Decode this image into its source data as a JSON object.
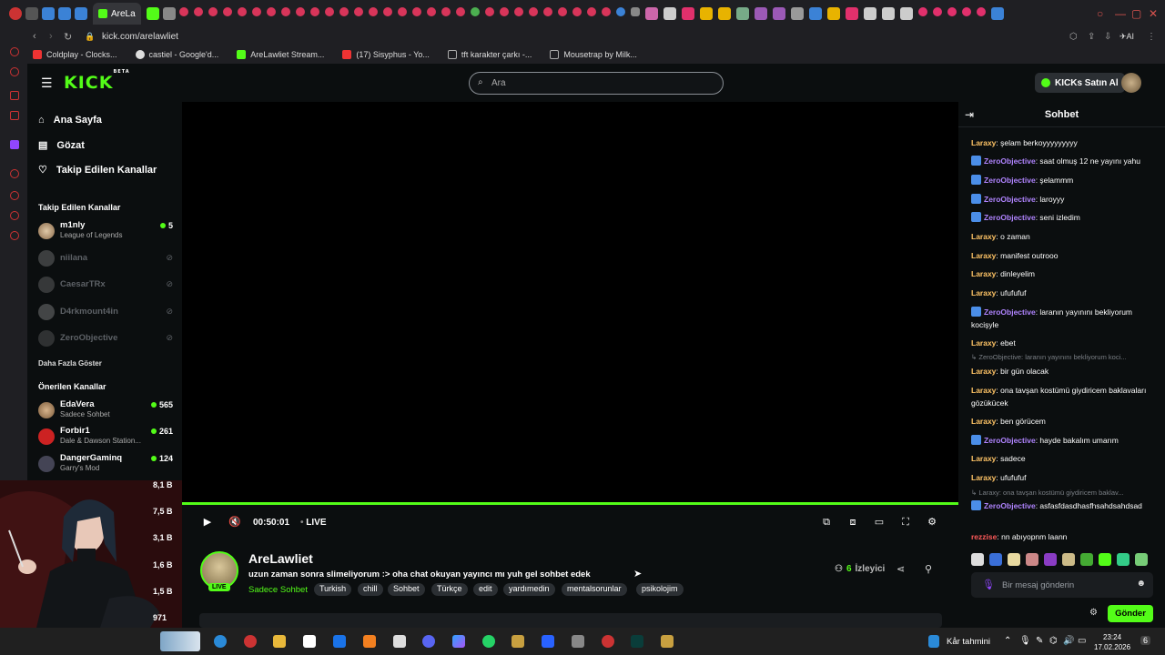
{
  "browser": {
    "tab_title": "AreLa",
    "url": "kick.com/arelawliet",
    "ai_label": "AI",
    "bookmarks": [
      "Coldplay - Clocks...",
      "castiel - Google'd...",
      "AreLawliet Stream...",
      "(17) Sisyphus - Yo...",
      "tft karakter çarkı -...",
      "Mousetrap by Milk..."
    ]
  },
  "header": {
    "logo": "KICK",
    "logo_beta": "BETA",
    "search_placeholder": "Ara",
    "kicks_button": "KICKs Satın Al"
  },
  "sidebar": {
    "nav": [
      {
        "label": "Ana Sayfa",
        "icon": "home-icon"
      },
      {
        "label": "Gözat",
        "icon": "browse-icon"
      },
      {
        "label": "Takip Edilen Kanallar",
        "icon": "heart-icon"
      }
    ],
    "followed_title": "Takip Edilen Kanallar",
    "followed": [
      {
        "name": "m1nly",
        "sub": "League of Legends",
        "viewers": "5",
        "live": true
      },
      {
        "name": "niilana",
        "live": false
      },
      {
        "name": "CaesarTRx",
        "live": false
      },
      {
        "name": "D4rkmount4in",
        "live": false
      },
      {
        "name": "ZeroObjective",
        "live": false
      }
    ],
    "show_more": "Daha Fazla Göster",
    "recommended_title": "Önerilen Kanallar",
    "recommended": [
      {
        "name": "EdaVera",
        "sub": "Sadece Sohbet",
        "viewers": "565"
      },
      {
        "name": "Forbir1",
        "sub": "Dale & Dawson Station...",
        "viewers": "261"
      },
      {
        "name": "DangerGaminq",
        "sub": "Garry's Mod",
        "viewers": "124"
      }
    ],
    "hidden_counts": [
      "8,1 B",
      "7,5 B",
      "3,1 B",
      "1,6 B",
      "1,5 B",
      "971"
    ]
  },
  "player": {
    "time": "00:50:01",
    "live_label": "LIVE"
  },
  "stream": {
    "channel": "AreLawliet",
    "live_badge": "LIVE",
    "title": "uzun zaman sonra slimeliyorum :> oha chat okuyan yayıncı mı yuh gel sohbet edek",
    "category": "Sadece Sohbet",
    "tags": [
      "Turkish",
      "chill",
      "Sohbet",
      "Türkçe",
      "edit",
      "yardımedin",
      "mentalsorunlar",
      "psikolojim"
    ],
    "viewers_count": "6",
    "viewers_label": "İzleyici"
  },
  "chat": {
    "title": "Sohbet",
    "messages": [
      {
        "user": "Laraxy",
        "text": "şelam berkoyyyyyyyyy",
        "type": "lar"
      },
      {
        "user": "ZeroObjective",
        "text": "saat olmuş 12 ne yayını yahu",
        "type": "zero"
      },
      {
        "user": "ZeroObjective",
        "text": "şelammm",
        "type": "zero"
      },
      {
        "user": "ZeroObjective",
        "text": "laroyyy",
        "type": "zero"
      },
      {
        "user": "ZeroObjective",
        "text": "seni izledim",
        "type": "zero"
      },
      {
        "user": "Laraxy",
        "text": "o zaman",
        "type": "lar"
      },
      {
        "user": "Laraxy",
        "text": "manifest outrooo",
        "type": "lar"
      },
      {
        "user": "Laraxy",
        "text": "dinleyelim",
        "type": "lar"
      },
      {
        "user": "Laraxy",
        "text": "ufufufuf",
        "type": "lar"
      },
      {
        "user": "ZeroObjective",
        "text": "laranın yayınını bekliyorum kocişyle",
        "type": "zero"
      },
      {
        "user": "Laraxy",
        "text": "ebet",
        "type": "lar"
      },
      {
        "reply": "ZeroObjective: laranın yayınını bekliyorum koci..."
      },
      {
        "user": "Laraxy",
        "text": "bir gün olacak",
        "type": "lar"
      },
      {
        "user": "Laraxy",
        "text": "ona tavşan kostümü giydiricem baklavaları gözükücek",
        "type": "lar"
      },
      {
        "user": "Laraxy",
        "text": "ben görücem",
        "type": "lar"
      },
      {
        "user": "ZeroObjective",
        "text": "hayde bakalım umarım",
        "type": "zero"
      },
      {
        "user": "Laraxy",
        "text": "sadece",
        "type": "lar"
      },
      {
        "user": "Laraxy",
        "text": "ufufufuf",
        "type": "lar"
      },
      {
        "reply": "Laraxy: ona tavşan kostümü giydiricem baklav..."
      },
      {
        "user": "ZeroObjective",
        "text": "asfasfdasdhasfhsahdsahdsad",
        "type": "zero"
      },
      {
        "user": "rezzise",
        "text": "nn abıyopnm laann",
        "type": "rez"
      }
    ],
    "input_placeholder": "Bir mesaj gönderin",
    "send_label": "Gönder"
  },
  "taskbar": {
    "weather": "Kår tahmini",
    "time": "23:24",
    "date": "17.02.2026",
    "notif_count": "6"
  },
  "colors": {
    "accent": "#53fc18",
    "laraxy": "#ffc466",
    "zero": "#b084ff",
    "rezzise": "#ff5a5a"
  }
}
